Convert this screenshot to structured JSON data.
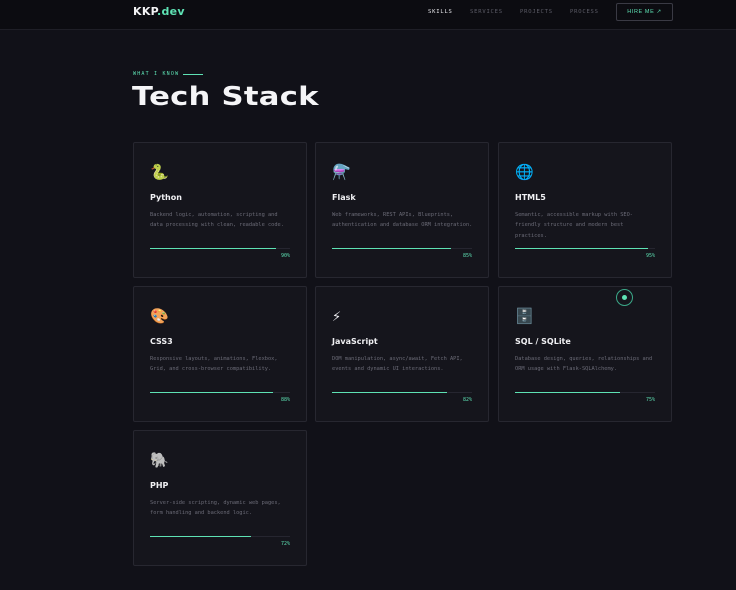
{
  "nav": {
    "logo_main": "KKP",
    "logo_accent": ".dev",
    "links": [
      "SKILLS",
      "SERVICES",
      "PROJECTS",
      "PROCESS"
    ],
    "hire": "HIRE ME ↗"
  },
  "section": {
    "eyebrow": "WHAT I KNOW",
    "title": "Tech Stack"
  },
  "skills": [
    {
      "icon": "🐍",
      "name": "Python",
      "desc": "Backend logic, automation, scripting and data processing with clean, readable code.",
      "percent": 90,
      "label": "90%"
    },
    {
      "icon": "⚗️",
      "name": "Flask",
      "desc": "Web frameworks, REST APIs, Blueprints, authentication and database ORM integration.",
      "percent": 85,
      "label": "85%"
    },
    {
      "icon": "🌐",
      "name": "HTML5",
      "desc": "Semantic, accessible markup with SEO-friendly structure and modern best practices.",
      "percent": 95,
      "label": "95%"
    },
    {
      "icon": "🎨",
      "name": "CSS3",
      "desc": "Responsive layouts, animations, Flexbox, Grid, and cross-browser compatibility.",
      "percent": 88,
      "label": "88%"
    },
    {
      "icon": "⚡",
      "name": "JavaScript",
      "desc": "DOM manipulation, async/await, Fetch API, events and dynamic UI interactions.",
      "percent": 82,
      "label": "82%"
    },
    {
      "icon": "🗄️",
      "name": "SQL / SQLite",
      "desc": "Database design, queries, relationships and ORM usage with Flask-SQLAlchemy.",
      "percent": 75,
      "label": "75%"
    },
    {
      "icon": "🐘",
      "name": "PHP",
      "desc": "Server-side scripting, dynamic web pages, form handling and backend logic.",
      "percent": 72,
      "label": "72%"
    }
  ]
}
